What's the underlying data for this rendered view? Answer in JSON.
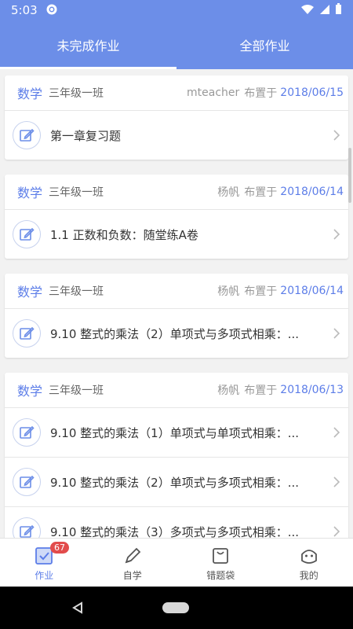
{
  "status_bar": {
    "time": "5:03",
    "icons": [
      "gear-icon",
      "wifi-icon",
      "signal-icon",
      "battery-icon"
    ]
  },
  "tabs": [
    {
      "label": "未完成作业",
      "active": true
    },
    {
      "label": "全部作业",
      "active": false
    }
  ],
  "groups": [
    {
      "subject": "数学",
      "class": "三年级一班",
      "teacher": "mteacher",
      "assigned_label": "布置于",
      "date": "2018/06/15",
      "items": [
        {
          "title": "第一章复习题"
        }
      ]
    },
    {
      "subject": "数学",
      "class": "三年级一班",
      "teacher": "杨帆",
      "assigned_label": "布置于",
      "date": "2018/06/14",
      "items": [
        {
          "title": "1.1 正数和负数：随堂练A卷"
        }
      ]
    },
    {
      "subject": "数学",
      "class": "三年级一班",
      "teacher": "杨帆",
      "assigned_label": "布置于",
      "date": "2018/06/14",
      "items": [
        {
          "title": "9.10 整式的乘法（2）单项式与多项式相乘：..."
        }
      ]
    },
    {
      "subject": "数学",
      "class": "三年级一班",
      "teacher": "杨帆",
      "assigned_label": "布置于",
      "date": "2018/06/13",
      "items": [
        {
          "title": "9.10 整式的乘法（1）单项式与单项式相乘：..."
        },
        {
          "title": "9.10 整式的乘法（2）单项式与多项式相乘：..."
        },
        {
          "title": "9.10 整式的乘法（3）多项式与多项式相乘：..."
        }
      ]
    }
  ],
  "bottom_nav": [
    {
      "label": "作业",
      "icon": "homework-icon",
      "active": true,
      "badge": "67"
    },
    {
      "label": "自学",
      "icon": "pencil-icon",
      "active": false
    },
    {
      "label": "错题袋",
      "icon": "bag-icon",
      "active": false
    },
    {
      "label": "我的",
      "icon": "profile-icon",
      "active": false
    }
  ],
  "colors": {
    "primary": "#6c8ee8",
    "accent": "#5c7de8",
    "badge": "#e24b4b"
  }
}
